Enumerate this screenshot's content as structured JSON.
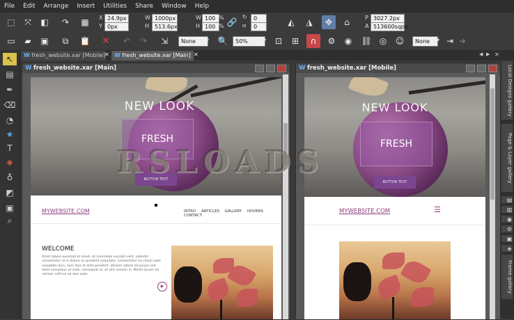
{
  "menu": [
    "File",
    "Edit",
    "Arrange",
    "Insert",
    "Utilities",
    "Share",
    "Window",
    "Help"
  ],
  "infobar": {
    "x_label": "X",
    "x_value": "24.9px",
    "y_label": "Y",
    "y_value": "0px",
    "w_label": "W",
    "w_value": "1000px",
    "h_label": "H",
    "h_value": "513.6px",
    "wpct_label": "W",
    "wpct_value": "100",
    "hpct_label": "H",
    "hpct_value": "100",
    "pct_unit": "%",
    "rot_value": "0",
    "skew_value": "0",
    "p_label": "P",
    "p_value": "3027.2px",
    "a_label": "A",
    "a_value": "513600sqpx"
  },
  "standardbar": {
    "quality_value": "None",
    "zoom_value": "50%",
    "name_value": "None"
  },
  "tabs": [
    {
      "label": "fresh_website.xar [Mobile]",
      "icon_letter": "W"
    },
    {
      "label": "fresh_website.xar [Main]",
      "icon_letter": "W"
    }
  ],
  "tab_nav": {
    "left": "◀",
    "right": "▶",
    "close": "✕"
  },
  "doc_main": {
    "title": "fresh_website.xar [Main]",
    "icon_letter": "W"
  },
  "doc_mobile": {
    "title": "fresh_website.xar [Mobile]",
    "icon_letter": "W"
  },
  "site": {
    "headline": "NEW LOOK",
    "fresh": "FRESH",
    "button_text": "BUTTON TEXT",
    "logo": "MYWEBSITE.COM",
    "nav": [
      "INTRO",
      "ARTICLES",
      "GALLERY",
      "HOVERS",
      "CONTACT"
    ],
    "welcome": "WELCOME",
    "lorem": "Amet labore euismod et amet, sit commodo suscipit velit. Lobortis consectetur et in dolore ex proident vulputate. Consectetur ea cillum aute voluptate duis, nam duis et ante proident. Veniam labore ad ipsum sed dolor excepteur ut aute, consequat ut, et sint veniam in. Minim ipsum ad veniam velit ex ea duis aute.",
    "play": "▶",
    "hamburger": "☰"
  },
  "galleries": [
    "Local Designs gallery",
    "Page & Layer gallery",
    "Frame gallery"
  ],
  "watermark": "RSLOADS",
  "colors": {
    "accent": "#8e3c7c",
    "fresh_box": "#965aa0",
    "button": "#7c4590"
  }
}
